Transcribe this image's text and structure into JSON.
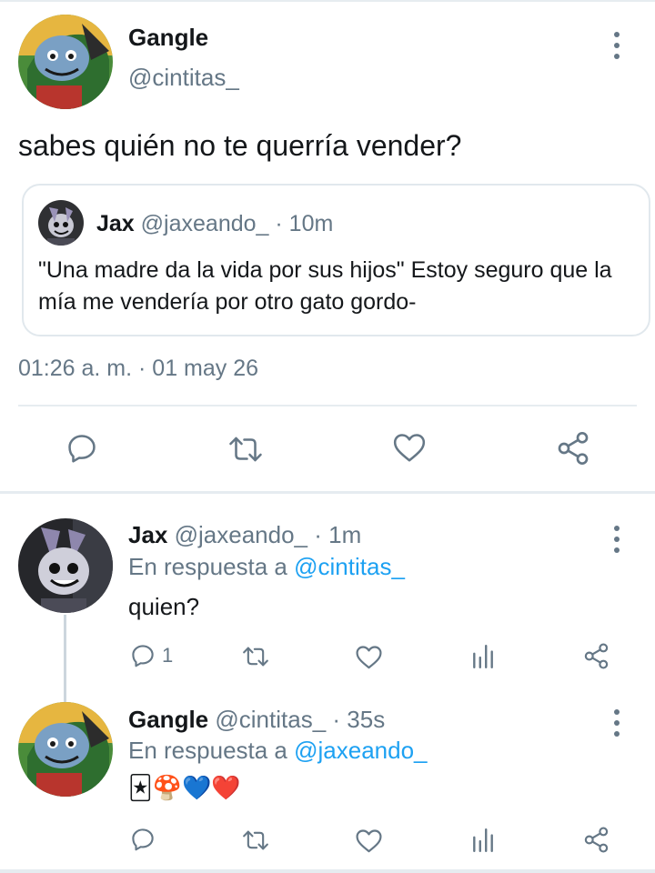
{
  "main_tweet": {
    "author_name": "Gangle",
    "author_handle": "@cintitas_",
    "text": "sabes quién no te querría vender?",
    "timestamp": "01:26 a. m. · 01 may 26",
    "quoted": {
      "author_name": "Jax",
      "author_handle": "@jaxeando_",
      "separator": "·",
      "time": "10m",
      "text": "\"Una madre da la vida por sus hijos\" Estoy seguro que la mía me vendería por otro gato gordo-"
    },
    "actions": [
      "reply-icon",
      "retweet-icon",
      "like-icon",
      "share-icon"
    ]
  },
  "replies": [
    {
      "author_name": "Jax",
      "author_handle": "@jaxeando_",
      "separator": "·",
      "time": "1m",
      "reply_prefix": "En respuesta a",
      "reply_to": "@cintitas_",
      "text": "quien?",
      "reply_count": "1"
    },
    {
      "author_name": "Gangle",
      "author_handle": "@cintitas_",
      "separator": "·",
      "time": "35s",
      "reply_prefix": "En respuesta a",
      "reply_to": "@jaxeando_",
      "text": "🃏🍄💙❤️",
      "reply_count": ""
    }
  ],
  "colors": {
    "accent": "#1da1f2",
    "secondary_text": "#657786",
    "divider": "#e6ecf0"
  }
}
